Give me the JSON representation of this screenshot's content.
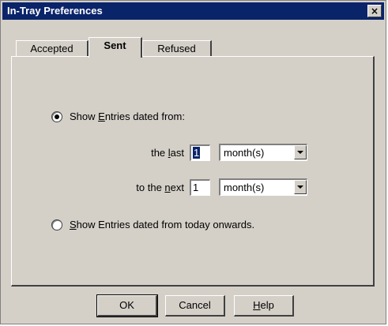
{
  "window": {
    "title": "In-Tray Preferences",
    "close_glyph": "×",
    "close_icon": "close-icon"
  },
  "tabs": [
    {
      "label": "Accepted",
      "active": false
    },
    {
      "label": "Sent",
      "active": true
    },
    {
      "label": "Refused",
      "active": false
    }
  ],
  "options": {
    "dated_from": {
      "pre": "Show ",
      "mnemonic": "E",
      "post": "ntries dated from:",
      "selected": true
    },
    "last": {
      "label_pre": "the ",
      "label_mnemonic": "l",
      "label_post": "ast",
      "value": "1",
      "unit": "month(s)"
    },
    "next": {
      "label_pre": "to the ",
      "label_mnemonic": "n",
      "label_post": "ext",
      "value": "1",
      "unit": "month(s)"
    },
    "onwards": {
      "mnemonic": "S",
      "post": "how Entries dated from today onwards.",
      "selected": false
    }
  },
  "buttons": {
    "ok": "OK",
    "cancel": "Cancel",
    "help_mnemonic": "H",
    "help_post": "elp"
  }
}
